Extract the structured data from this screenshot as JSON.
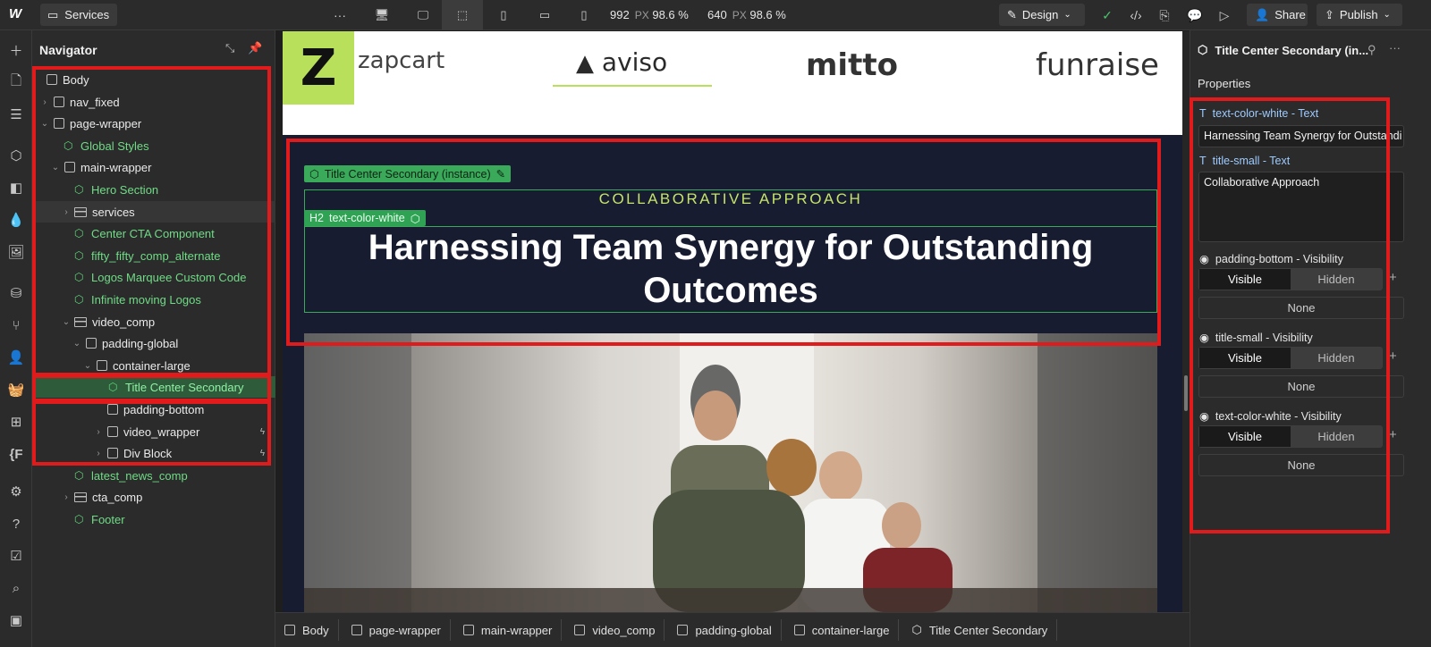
{
  "topbar": {
    "logo": "W",
    "pages_label": "Services",
    "more": "···",
    "width_value": "992",
    "width_unit": "PX",
    "width_zoom": "98.6 %",
    "height_value": "640",
    "height_unit": "PX",
    "height_zoom": "98.6 %",
    "design_label": "Design",
    "share_label": "Share",
    "publish_label": "Publish"
  },
  "navigator": {
    "title": "Navigator",
    "items": [
      {
        "label": "Body"
      },
      {
        "label": "nav_fixed"
      },
      {
        "label": "page-wrapper"
      },
      {
        "label": "Global Styles"
      },
      {
        "label": "main-wrapper"
      },
      {
        "label": "Hero Section"
      },
      {
        "label": "services"
      },
      {
        "label": "Center CTA Component"
      },
      {
        "label": "fifty_fifty_comp_alternate"
      },
      {
        "label": "Logos Marquee Custom Code"
      },
      {
        "label": "Infinite moving Logos"
      },
      {
        "label": "video_comp"
      },
      {
        "label": "padding-global"
      },
      {
        "label": "container-large"
      },
      {
        "label": "Title Center Secondary"
      },
      {
        "label": "padding-bottom"
      },
      {
        "label": "video_wrapper"
      },
      {
        "label": "Div Block"
      },
      {
        "label": "latest_news_comp"
      },
      {
        "label": "cta_comp"
      },
      {
        "label": "Footer"
      }
    ]
  },
  "canvas": {
    "logos": [
      "zapcart",
      "aviso",
      "mitto",
      "funraise"
    ],
    "instance_tag": "Title Center Secondary (instance)",
    "h2_tag_prefix": "H2",
    "h2_tag": "text-color-white",
    "eyebrow": "COLLABORATIVE APPROACH",
    "heading": "Harnessing Team Synergy for Outstanding Outcomes"
  },
  "breadcrumb": [
    "Body",
    "page-wrapper",
    "main-wrapper",
    "video_comp",
    "padding-global",
    "container-large",
    "Title Center Secondary"
  ],
  "properties": {
    "title": "Title Center Secondary (in...",
    "subtitle": "Properties",
    "field1_label": "text-color-white - Text",
    "field1_value": "Harnessing Team Synergy for Outstandi",
    "field2_label": "title-small - Text",
    "field2_value": "Collaborative Approach",
    "vis1_label": "padding-bottom - Visibility",
    "vis2_label": "title-small - Visibility",
    "vis3_label": "text-color-white - Visibility",
    "visible": "Visible",
    "hidden": "Hidden",
    "none": "None"
  },
  "colors": {
    "highlight": "#e11b1b",
    "component_green": "#3aa95a",
    "eyebrow_lime": "#c6e36a",
    "canvas_navy": "#171c30"
  }
}
